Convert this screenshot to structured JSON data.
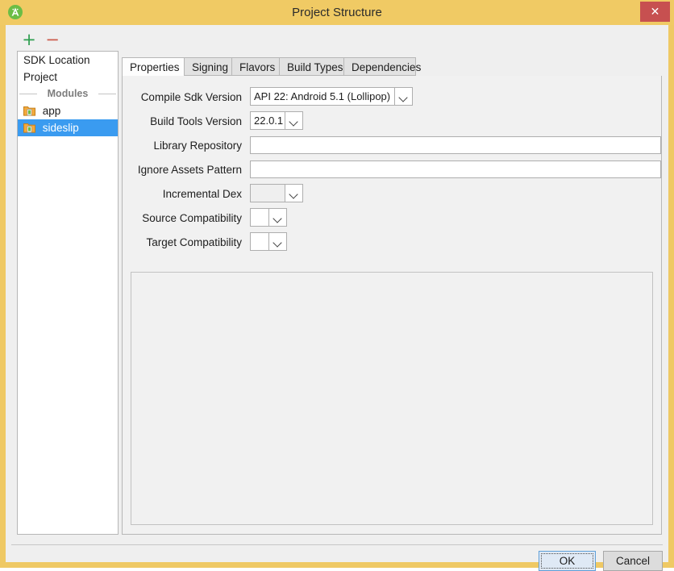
{
  "window": {
    "title": "Project Structure",
    "app_icon": "android-studio-icon",
    "close_label": "✕",
    "titlebar_color": "#f0ca64",
    "close_color": "#c75050"
  },
  "sidebar": {
    "toolbar": {
      "add_label": "+",
      "remove_label": "−"
    },
    "items": [
      {
        "label": "SDK Location",
        "type": "entry",
        "selected": false
      },
      {
        "label": "Project",
        "type": "entry",
        "selected": false
      },
      {
        "label": "Modules",
        "type": "separator",
        "selected": false
      },
      {
        "label": "app",
        "type": "module",
        "selected": false
      },
      {
        "label": "sideslip",
        "type": "module",
        "selected": true
      }
    ],
    "selection_color": "#3a9bf0"
  },
  "tabs": [
    {
      "label": "Properties",
      "active": true
    },
    {
      "label": "Signing",
      "active": false
    },
    {
      "label": "Flavors",
      "active": false
    },
    {
      "label": "Build Types",
      "active": false
    },
    {
      "label": "Dependencies",
      "active": false
    }
  ],
  "form": {
    "rows": [
      {
        "label": "Compile Sdk Version",
        "control": "combo",
        "value": "API 22: Android 5.1 (Lollipop)",
        "disabled": false
      },
      {
        "label": "Build Tools Version",
        "control": "combo",
        "value": "22.0.1",
        "disabled": false
      },
      {
        "label": "Library Repository",
        "control": "text",
        "value": "",
        "placeholder": ""
      },
      {
        "label": "Ignore Assets Pattern",
        "control": "text",
        "value": "",
        "placeholder": ""
      },
      {
        "label": "Incremental Dex",
        "control": "combo",
        "value": "",
        "disabled": true
      },
      {
        "label": "Source Compatibility",
        "control": "combo",
        "value": "",
        "disabled": false
      },
      {
        "label": "Target Compatibility",
        "control": "combo",
        "value": "",
        "disabled": false
      }
    ]
  },
  "buttons": {
    "ok_label": "OK",
    "cancel_label": "Cancel"
  }
}
